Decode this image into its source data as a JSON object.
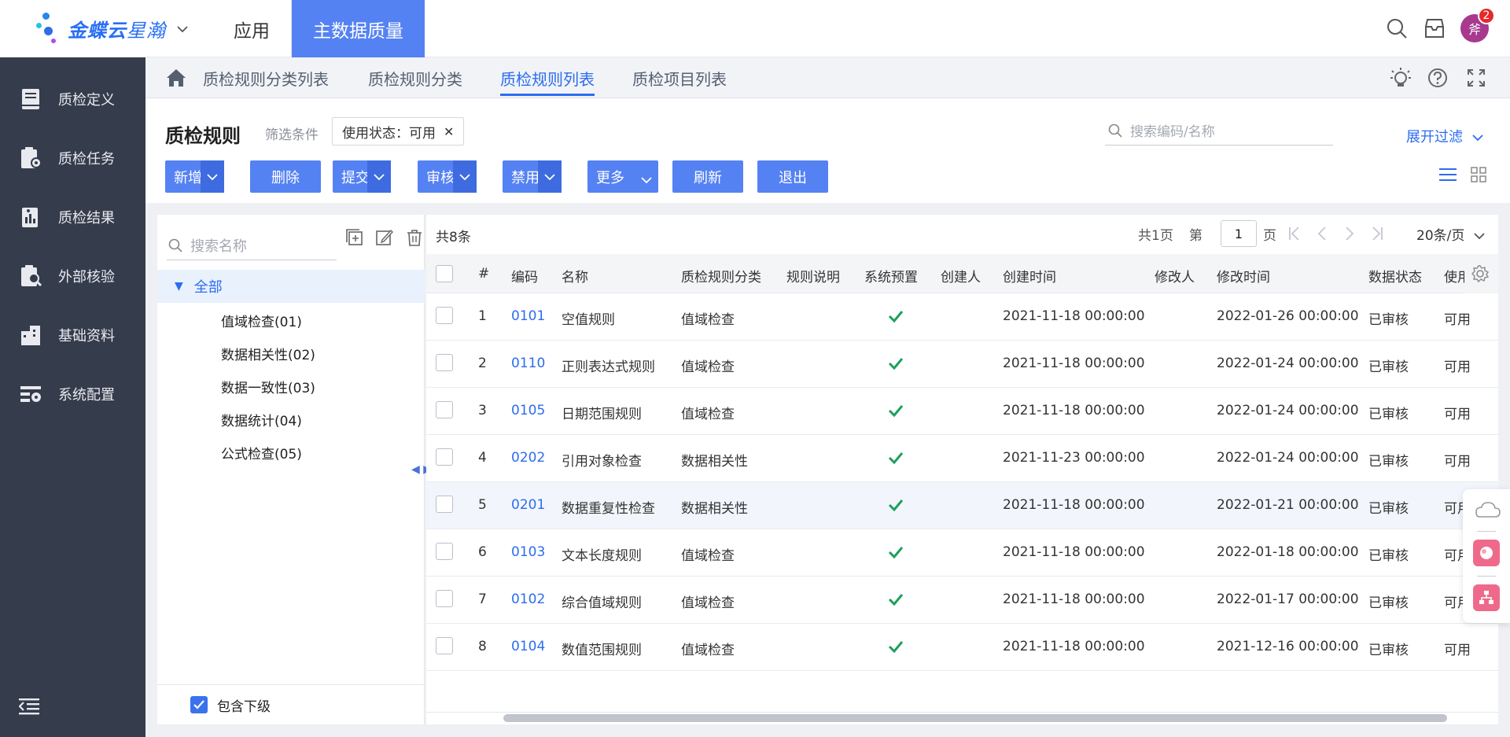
{
  "brand": {
    "logo_text_bold": "金蝶云",
    "logo_text_light": "星瀚"
  },
  "top_nav": {
    "app_label": "应用",
    "active_label": "主数据质量",
    "notification_count": "2",
    "avatar_text": "斧"
  },
  "sidebar": {
    "items": [
      {
        "label": "质检定义",
        "icon": "book-icon"
      },
      {
        "label": "质检任务",
        "icon": "task-clipboard-icon"
      },
      {
        "label": "质检结果",
        "icon": "report-icon"
      },
      {
        "label": "外部核验",
        "icon": "search-clipboard-icon"
      },
      {
        "label": "基础资料",
        "icon": "building-icon"
      },
      {
        "label": "系统配置",
        "icon": "settings-panel-icon"
      }
    ]
  },
  "tabs": [
    "质检规则分类列表",
    "质检规则分类",
    "质检规则列表",
    "质检项目列表"
  ],
  "active_tab": "质检规则列表",
  "header": {
    "title": "质检规则",
    "filter_label": "筛选条件",
    "filter_chip": "使用状态：可用",
    "search_placeholder": "搜索编码/名称",
    "expand_filter": "展开过滤"
  },
  "toolbar": {
    "add": "新增",
    "delete": "删除",
    "submit": "提交",
    "audit": "审核",
    "disable": "禁用",
    "more": "更多",
    "refresh": "刷新",
    "exit": "退出"
  },
  "tree": {
    "search_placeholder": "搜索名称",
    "root": "全部",
    "nodes": [
      "值域检查(01)",
      "数据相关性(02)",
      "数据一致性(03)",
      "数据统计(04)",
      "公式检查(05)"
    ],
    "include_children": "包含下级"
  },
  "grid": {
    "total": "共8条",
    "pages_total": "共1页",
    "page_prefix": "第",
    "page_value": "1",
    "page_suffix": "页",
    "page_size": "20条/页",
    "columns": [
      "#",
      "编码",
      "名称",
      "质检规则分类",
      "规则说明",
      "系统预置",
      "创建人",
      "创建时间",
      "修改人",
      "修改时间",
      "数据状态",
      "使用"
    ],
    "rows": [
      {
        "no": "1",
        "code": "0101",
        "name": "空值规则",
        "category": "值域检查",
        "created": "2021-11-18 00:00:00",
        "modified": "2022-01-26 00:00:00",
        "status": "已审核",
        "use": "可用"
      },
      {
        "no": "2",
        "code": "0110",
        "name": "正则表达式规则",
        "category": "值域检查",
        "created": "2021-11-18 00:00:00",
        "modified": "2022-01-24 00:00:00",
        "status": "已审核",
        "use": "可用"
      },
      {
        "no": "3",
        "code": "0105",
        "name": "日期范围规则",
        "category": "值域检查",
        "created": "2021-11-18 00:00:00",
        "modified": "2022-01-24 00:00:00",
        "status": "已审核",
        "use": "可用"
      },
      {
        "no": "4",
        "code": "0202",
        "name": "引用对象检查",
        "category": "数据相关性",
        "created": "2021-11-23 00:00:00",
        "modified": "2022-01-24 00:00:00",
        "status": "已审核",
        "use": "可用"
      },
      {
        "no": "5",
        "code": "0201",
        "name": "数据重复性检查",
        "category": "数据相关性",
        "created": "2021-11-18 00:00:00",
        "modified": "2022-01-21 00:00:00",
        "status": "已审核",
        "use": "可用"
      },
      {
        "no": "6",
        "code": "0103",
        "name": "文本长度规则",
        "category": "值域检查",
        "created": "2021-11-18 00:00:00",
        "modified": "2022-01-18 00:00:00",
        "status": "已审核",
        "use": "可用"
      },
      {
        "no": "7",
        "code": "0102",
        "name": "综合值域规则",
        "category": "值域检查",
        "created": "2021-11-18 00:00:00",
        "modified": "2022-01-17 00:00:00",
        "status": "已审核",
        "use": "可用"
      },
      {
        "no": "8",
        "code": "0104",
        "name": "数值范围规则",
        "category": "值域检查",
        "created": "2021-11-18 00:00:00",
        "modified": "2021-12-16 00:00:00",
        "status": "已审核",
        "use": "可用"
      }
    ]
  },
  "colors": {
    "primary": "#5582f3",
    "link": "#2c6cef",
    "sidebar_bg": "#353c4b",
    "check_green": "#1f9f5b"
  }
}
